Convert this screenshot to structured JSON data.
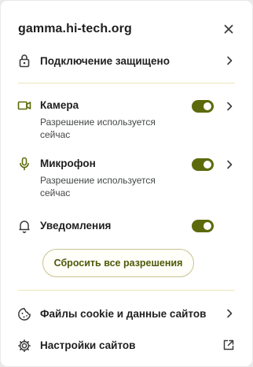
{
  "header": {
    "site": "gamma.hi-tech.org"
  },
  "connection": {
    "label": "Подключение защищено"
  },
  "permissions": [
    {
      "label": "Камера",
      "status": "Разрешение используется сейчас",
      "enabled": true,
      "icon": "camera-icon"
    },
    {
      "label": "Микрофон",
      "status": "Разрешение используется сейчас",
      "enabled": true,
      "icon": "microphone-icon"
    },
    {
      "label": "Уведомления",
      "enabled": true,
      "icon": "bell-icon"
    }
  ],
  "reset_button": {
    "label": "Сбросить все разрешения"
  },
  "footer": {
    "cookies": {
      "label": "Файлы cookie и данные сайтов"
    },
    "settings": {
      "label": "Настройки сайтов"
    }
  },
  "colors": {
    "accent": "#5c6a0c",
    "divider": "#ece6b8"
  }
}
